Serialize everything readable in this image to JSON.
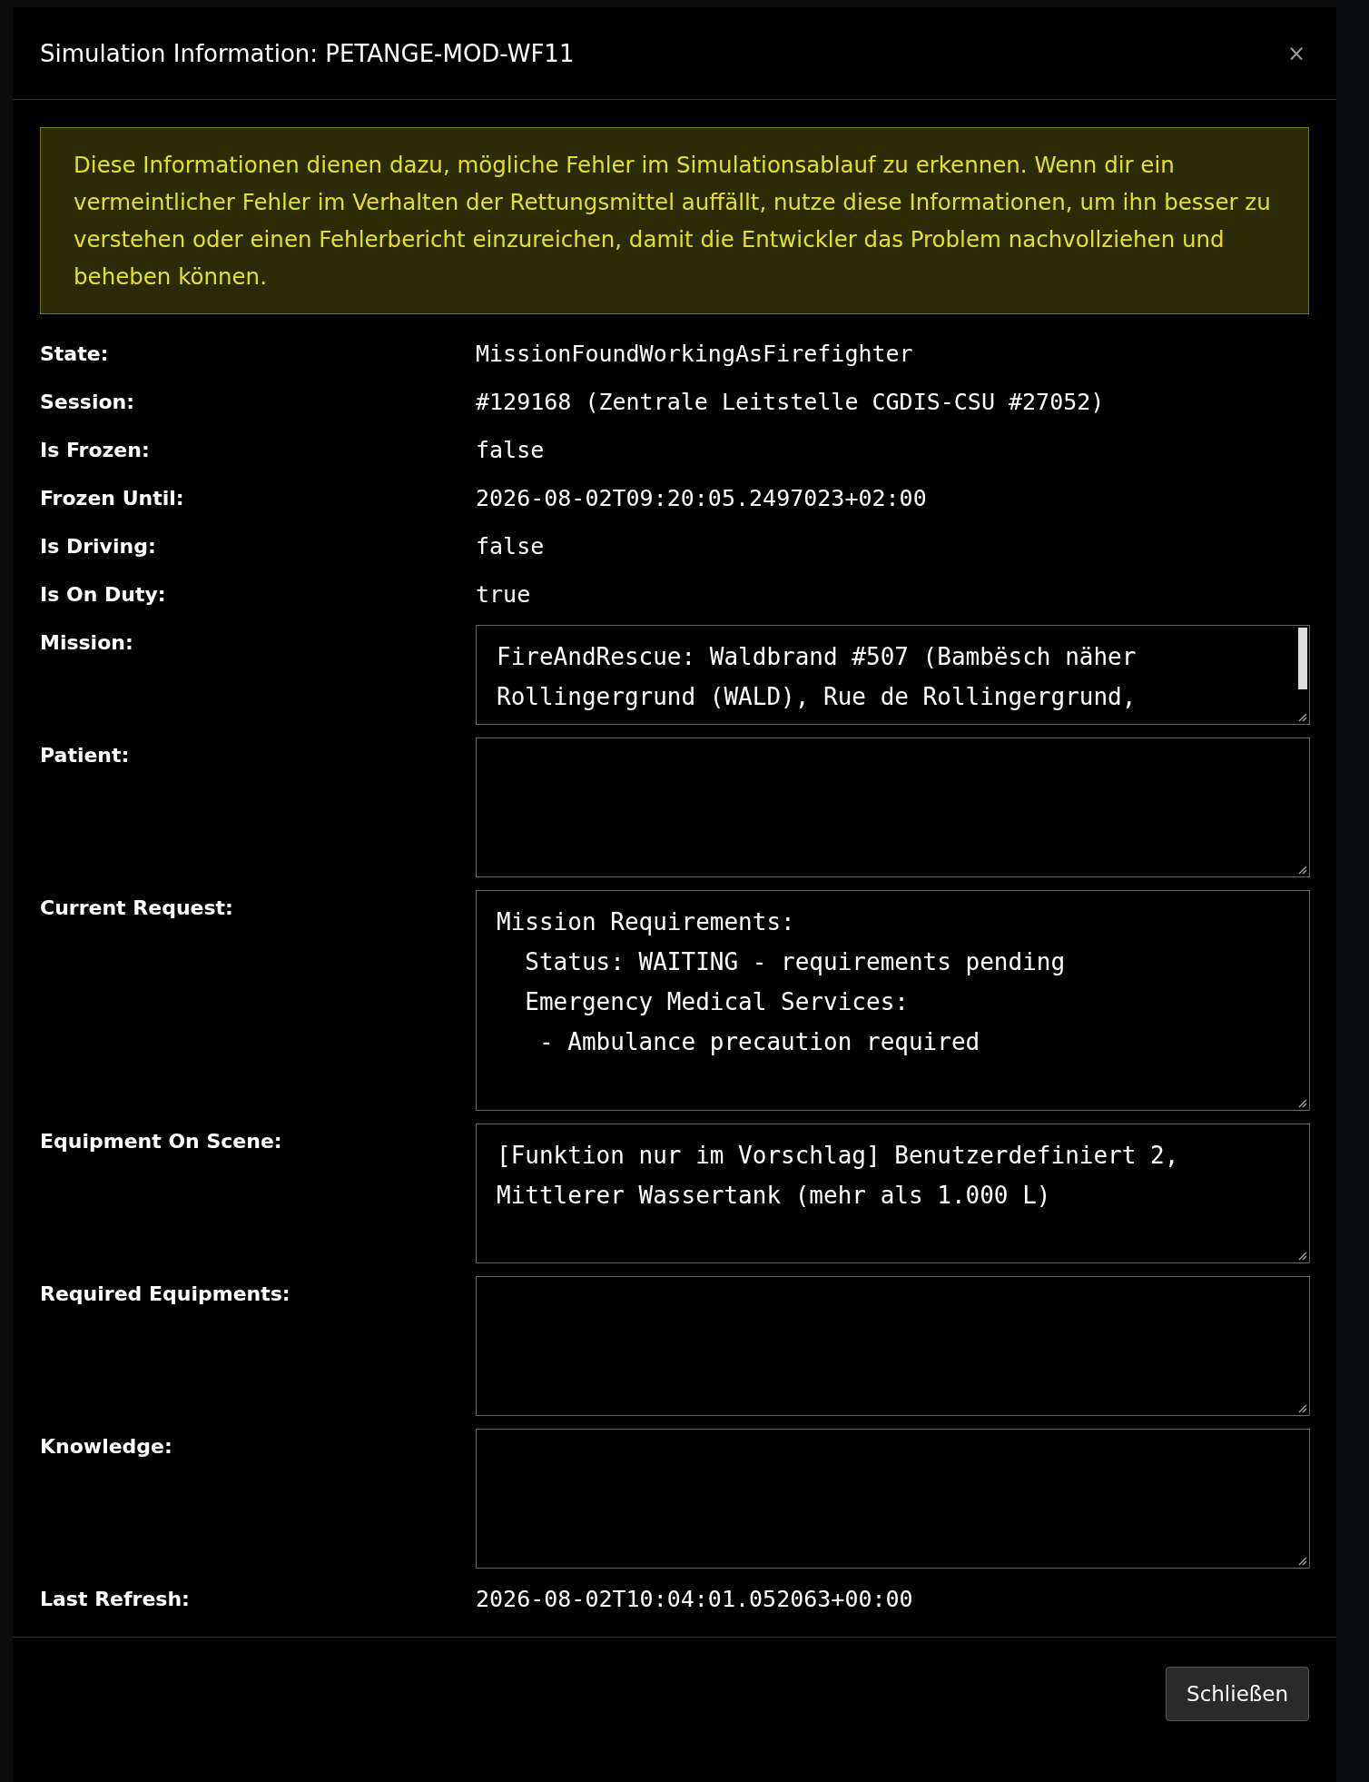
{
  "dialog": {
    "title": "Simulation Information: PETANGE-MOD-WF11",
    "close": "×"
  },
  "notice": "Diese Informationen dienen dazu, mögliche Fehler im Simulationsablauf zu erkennen. Wenn dir ein vermeintlicher Fehler im Verhalten der Rettungsmittel auffällt, nutze diese Informationen, um ihn besser zu verstehen oder einen Fehlerbericht einzureichen, damit die Entwickler das Problem nachvollziehen und beheben können.",
  "fields": [
    {
      "kind": "text",
      "label": "State:",
      "value": "MissionFoundWorkingAsFirefighter"
    },
    {
      "kind": "text",
      "label": "Session:",
      "value": "#129168 (Zentrale Leitstelle CGDIS-CSU #27052)"
    },
    {
      "kind": "text",
      "label": "Is Frozen:",
      "value": "false"
    },
    {
      "kind": "text",
      "label": "Frozen Until:",
      "value": "2026-08-02T09:20:05.2497023+02:00"
    },
    {
      "kind": "text",
      "label": "Is Driving:",
      "value": "false"
    },
    {
      "kind": "text",
      "label": "Is On Duty:",
      "value": "true"
    },
    {
      "kind": "scrollbox",
      "label": "Mission:",
      "value": "FireAndRescue: Waldbrand #507 (Bambësch näher\nRollingergrund (WALD), Rue de Rollingergrund,"
    },
    {
      "kind": "textarea",
      "label": "Patient:"
    },
    {
      "kind": "tallarea",
      "label": "Current Request:",
      "value": "Mission Requirements:\n  Status: WAITING - requirements pending\n  Emergency Medical Services:\n   - Ambulance precaution required"
    },
    {
      "kind": "textarea",
      "label": "Equipment On Scene:",
      "value": "[Funktion nur im Vorschlag] Benutzerdefiniert 2,\nMittlerer Wassertank (mehr als 1.000 L)"
    },
    {
      "kind": "textarea",
      "label": "Required Equipments:"
    },
    {
      "kind": "textarea",
      "label": "Knowledge:"
    },
    {
      "kind": "text",
      "label": "Last Refresh:",
      "value": "2026-08-02T10:04:01.052063+00:00"
    }
  ],
  "footer": {
    "button": "Schließen"
  }
}
